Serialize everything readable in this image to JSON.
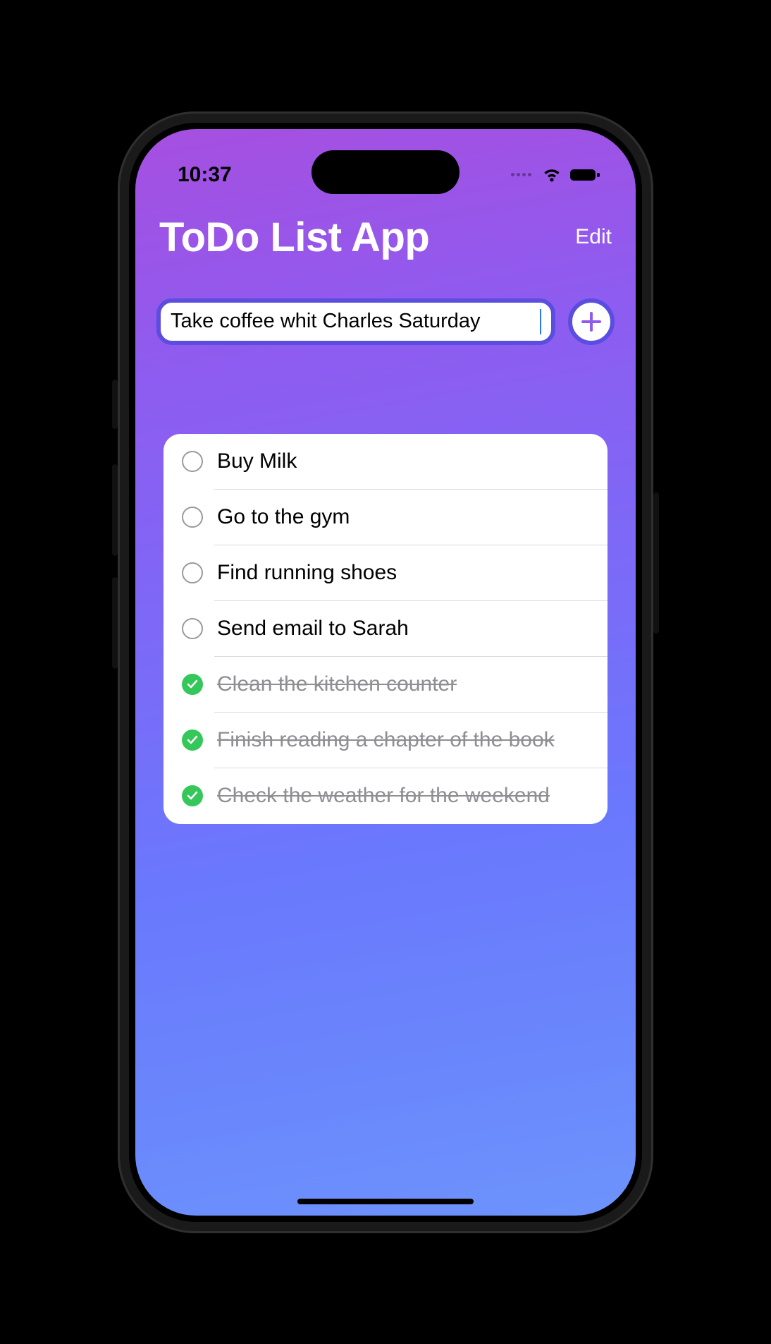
{
  "status": {
    "time": "10:37"
  },
  "header": {
    "title": "ToDo List App",
    "edit_label": "Edit"
  },
  "input": {
    "value": "Take coffee whit Charles Saturday",
    "add_icon": "plus-icon"
  },
  "todos": [
    {
      "text": "Buy Milk",
      "done": false
    },
    {
      "text": "Go to the gym",
      "done": false
    },
    {
      "text": "Find running shoes",
      "done": false
    },
    {
      "text": "Send email to Sarah",
      "done": false
    },
    {
      "text": "Clean the kitchen counter",
      "done": true
    },
    {
      "text": "Finish reading a chapter of the book",
      "done": true
    },
    {
      "text": "Check the weather for the weekend",
      "done": true
    }
  ],
  "colors": {
    "accent": "#5a4de0",
    "done_green": "#34c759"
  }
}
